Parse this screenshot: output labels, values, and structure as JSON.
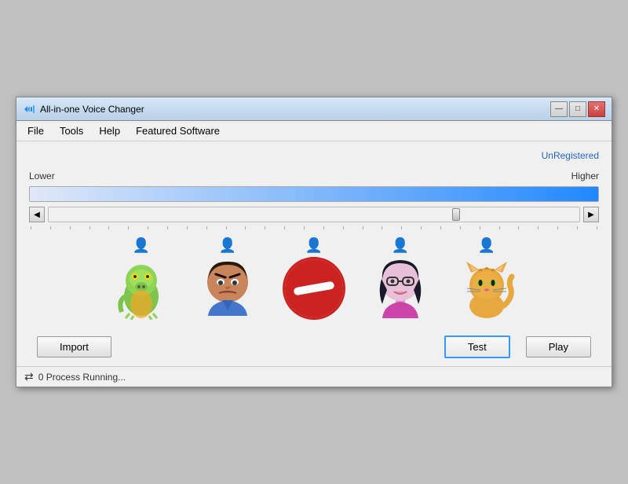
{
  "window": {
    "title": "All-in-one Voice Changer",
    "icon": "🎤"
  },
  "titlebar_buttons": {
    "minimize": "—",
    "maximize": "□",
    "close": "✕"
  },
  "menubar": {
    "items": [
      {
        "label": "File",
        "id": "file"
      },
      {
        "label": "Tools",
        "id": "tools"
      },
      {
        "label": "Help",
        "id": "help"
      },
      {
        "label": "Featured Software",
        "id": "featured-software"
      }
    ]
  },
  "registration": {
    "status": "UnRegistered"
  },
  "pitch": {
    "lower_label": "Lower",
    "higher_label": "Higher",
    "value": 76
  },
  "voices": [
    {
      "id": "dragon",
      "emoji": "🦎",
      "label": "dragon"
    },
    {
      "id": "man",
      "emoji": "😠",
      "label": "man"
    },
    {
      "id": "no-entry",
      "symbol": "🚫",
      "label": "no-entry"
    },
    {
      "id": "woman",
      "emoji": "👩",
      "label": "woman"
    },
    {
      "id": "cat",
      "emoji": "🐱",
      "label": "cat"
    }
  ],
  "buttons": {
    "import": "Import",
    "test": "Test",
    "play": "Play"
  },
  "statusbar": {
    "icon": "⇄",
    "text": "0 Process Running..."
  }
}
